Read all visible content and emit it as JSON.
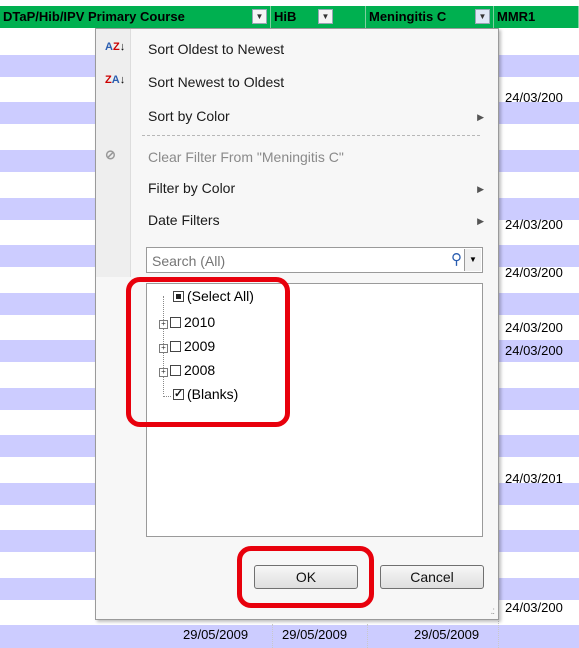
{
  "sheet": {
    "headers": [
      "DTaP/Hib/IPV Primary Course",
      "HiB",
      "Meningitis C",
      "MMR1"
    ],
    "mmr1_dates": [
      "24/03/200",
      "24/03/200",
      "24/03/200",
      "24/03/200",
      "24/03/200",
      "24/03/201",
      "24/03/200"
    ],
    "bottom_row": [
      "29/05/2009",
      "29/05/2009",
      "29/05/2009"
    ],
    "stripe_color": "#ccccff",
    "header_color": "#00b050"
  },
  "filter_menu": {
    "items": [
      {
        "label": "Sort Oldest to Newest",
        "icon": "sort-ascending-icon",
        "glyph": "A↓Z"
      },
      {
        "label": "Sort Newest to Oldest",
        "icon": "sort-descending-icon",
        "glyph": "Z↓A"
      },
      {
        "label": "Sort by Color",
        "icon": "",
        "glyph": ""
      },
      {
        "label": "Clear Filter From \"Meningitis C\"",
        "icon": "clear-filter-icon",
        "glyph": "⊘"
      },
      {
        "label": "Filter by Color",
        "icon": "",
        "glyph": ""
      },
      {
        "label": "Date Filters",
        "icon": "",
        "glyph": ""
      }
    ],
    "search_placeholder": "Search (All)",
    "tree": [
      {
        "label": "(Select All)",
        "state": "partial"
      },
      {
        "label": "2010",
        "state": "unchecked"
      },
      {
        "label": "2009",
        "state": "unchecked"
      },
      {
        "label": "2008",
        "state": "unchecked"
      },
      {
        "label": "(Blanks)",
        "state": "checked"
      }
    ],
    "ok_label": "OK",
    "cancel_label": "Cancel"
  },
  "annotation_color": "#e8000c"
}
